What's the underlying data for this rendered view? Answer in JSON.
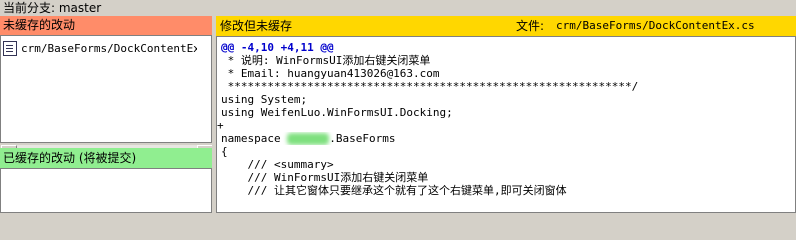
{
  "branch": {
    "label": "当前分支: master"
  },
  "unstaged": {
    "header": "未缓存的改动",
    "files": [
      "crm/BaseForms/DockContentEx.cs"
    ]
  },
  "staged": {
    "header": "已缓存的改动 (将被提交)"
  },
  "diff": {
    "status": "修改但未缓存",
    "file_label": "文件:",
    "file_path": "crm/BaseForms/DockContentEx.cs",
    "hunk": "@@ -4,10 +4,11 @@",
    "lines": [
      " * 说明: WinFormsUI添加右键关闭菜单",
      " * Email: huangyuan413026@163.com",
      " *************************************************************/",
      "using System;",
      "using WeifenLuo.WinFormsUI.Docking;",
      "+",
      "namespace ",
      ".BaseForms",
      "{",
      "    /// <summary>",
      "    /// WinFormsUI添加右键关闭菜单",
      "    /// 让其它窗体只要继承这个就有了这个右键菜单,即可关闭窗体"
    ]
  },
  "colors": {
    "unstaged_header": "#ff8c69",
    "staged_header": "#90ee90",
    "diff_header": "#ffd700",
    "hunk": "#0000cc"
  }
}
